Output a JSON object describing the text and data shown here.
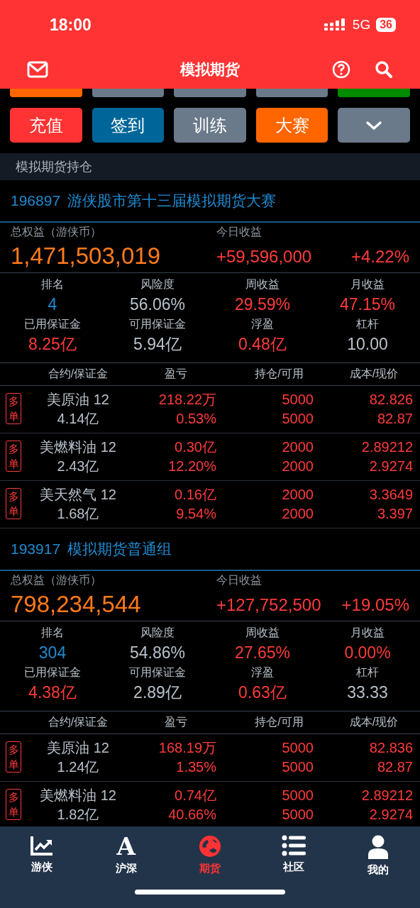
{
  "status_bar": {
    "time": "18:00",
    "network": "5G",
    "battery": "36"
  },
  "header": {
    "title": "模拟期货"
  },
  "partial_buttons": [
    {
      "color": "#ff6600"
    },
    {
      "color": "#6b7a8a"
    },
    {
      "color": "#6b7a8a"
    },
    {
      "color": "#6b7a8a"
    },
    {
      "color": "#008a00"
    }
  ],
  "buttons": [
    {
      "kind": "label",
      "label": "充值",
      "color": "#ff3333"
    },
    {
      "kind": "label",
      "label": "签到",
      "color": "#006699"
    },
    {
      "kind": "label",
      "label": "训练",
      "color": "#6b7a8a"
    },
    {
      "kind": "label",
      "label": "大赛",
      "color": "#ff6600"
    },
    {
      "kind": "expand",
      "color": "#6b7a8a"
    }
  ],
  "section_title": "模拟期货持仓",
  "accounts": [
    {
      "id": "196897",
      "name": "游侠股市第十三届模拟期货大赛",
      "equity_label": "总权益（游侠币）",
      "equity": "1,471,503,019",
      "today_label": "今日收益",
      "today_change": "+59,596,000",
      "today_pct": "+4.22%",
      "stats": [
        {
          "label": "排名",
          "value": "4",
          "color": "#1f8ad0"
        },
        {
          "label": "风险度",
          "value": "56.06%",
          "color": "#b8c2cc"
        },
        {
          "label": "周收益",
          "value": "29.59%",
          "color": "#ff3b3b"
        },
        {
          "label": "月收益",
          "value": "47.15%",
          "color": "#ff3b3b"
        },
        {
          "label": "已用保证金",
          "value": "8.25亿",
          "color": "#ff3b3b"
        },
        {
          "label": "可用保证金",
          "value": "5.94亿",
          "color": "#b8c2cc"
        },
        {
          "label": "浮盈",
          "value": "0.48亿",
          "color": "#ff3b3b"
        },
        {
          "label": "杠杆",
          "value": "10.00",
          "color": "#b8c2cc"
        }
      ],
      "columns": [
        "合约/保证金",
        "盈亏",
        "持仓/可用",
        "成本/现价"
      ],
      "positions": [
        {
          "side": "多单",
          "name": "美原油 12",
          "margin": "4.14亿",
          "pnl": "218.22万",
          "pnl_pct": "0.53%",
          "hold": "5000",
          "avail": "5000",
          "cost": "82.826",
          "price": "82.87"
        },
        {
          "side": "多单",
          "name": "美燃料油 12",
          "margin": "2.43亿",
          "pnl": "0.30亿",
          "pnl_pct": "12.20%",
          "hold": "2000",
          "avail": "2000",
          "cost": "2.89212",
          "price": "2.9274"
        },
        {
          "side": "多单",
          "name": "美天然气 12",
          "margin": "1.68亿",
          "pnl": "0.16亿",
          "pnl_pct": "9.54%",
          "hold": "2000",
          "avail": "2000",
          "cost": "3.3649",
          "price": "3.397"
        }
      ]
    },
    {
      "id": "193917",
      "name": "模拟期货普通组",
      "equity_label": "总权益（游侠币）",
      "equity": "798,234,544",
      "today_label": "今日收益",
      "today_change": "+127,752,500",
      "today_pct": "+19.05%",
      "stats": [
        {
          "label": "排名",
          "value": "304",
          "color": "#1f8ad0"
        },
        {
          "label": "风险度",
          "value": "54.86%",
          "color": "#b8c2cc"
        },
        {
          "label": "周收益",
          "value": "27.65%",
          "color": "#ff3b3b"
        },
        {
          "label": "月收益",
          "value": "0.00%",
          "color": "#ff3b3b"
        },
        {
          "label": "已用保证金",
          "value": "4.38亿",
          "color": "#ff3b3b"
        },
        {
          "label": "可用保证金",
          "value": "2.89亿",
          "color": "#b8c2cc"
        },
        {
          "label": "浮盈",
          "value": "0.63亿",
          "color": "#ff3b3b"
        },
        {
          "label": "杠杆",
          "value": "33.33",
          "color": "#b8c2cc"
        }
      ],
      "columns": [
        "合约/保证金",
        "盈亏",
        "持仓/可用",
        "成本/现价"
      ],
      "positions": [
        {
          "side": "多单",
          "name": "美原油 12",
          "margin": "1.24亿",
          "pnl": "168.19万",
          "pnl_pct": "1.35%",
          "hold": "5000",
          "avail": "5000",
          "cost": "82.836",
          "price": "82.87"
        },
        {
          "side": "多单",
          "name": "美燃料油 12",
          "margin": "1.82亿",
          "pnl": "0.74亿",
          "pnl_pct": "40.66%",
          "hold": "5000",
          "avail": "5000",
          "cost": "2.89212",
          "price": "2.9274"
        }
      ]
    }
  ],
  "tab_bar": [
    {
      "kind": "chart",
      "label": "游侠",
      "selected": false
    },
    {
      "kind": "letter",
      "glyph": "A",
      "label": "沪深",
      "selected": false
    },
    {
      "kind": "globe",
      "label": "期货",
      "selected": true
    },
    {
      "kind": "list",
      "label": "社区",
      "selected": false
    },
    {
      "kind": "person",
      "label": "我的",
      "selected": false
    }
  ]
}
